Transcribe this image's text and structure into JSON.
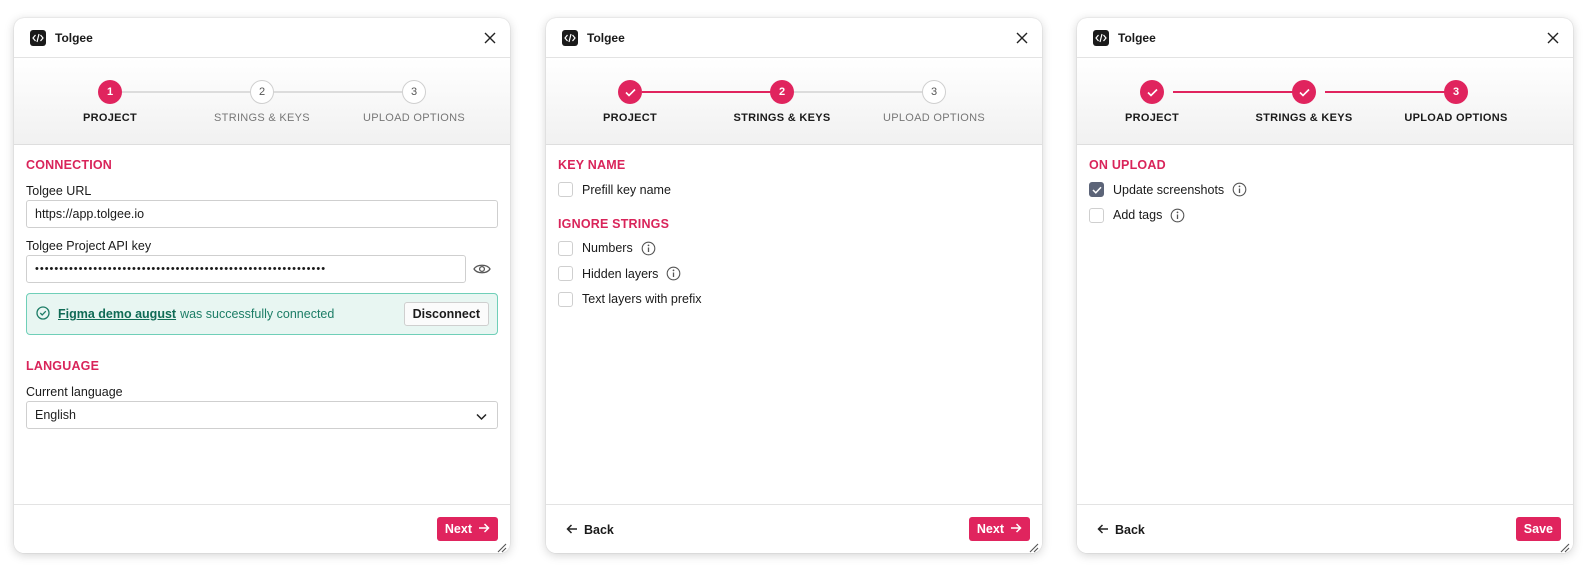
{
  "colors": {
    "accent": "#e0245e",
    "section": "#d9245a",
    "success_bg": "#e8f6f2",
    "success_border": "#6fcfb8",
    "checked": "#5c6478"
  },
  "app": {
    "title": "Tolgee",
    "icon": "code-brackets-icon"
  },
  "steps": [
    "PROJECT",
    "STRINGS & KEYS",
    "UPLOAD OPTIONS"
  ],
  "step_numbers": [
    "1",
    "2",
    "3"
  ],
  "panel1": {
    "connection_title": "CONNECTION",
    "url_label": "Tolgee URL",
    "url_value": "https://app.tolgee.io",
    "api_key_label": "Tolgee Project API key",
    "api_key_value": "••••••••••••••••••••••••••••••••••••••••••••••••••••••••••••",
    "success_project": "Figma demo august",
    "success_text": "was successfully connected",
    "disconnect_label": "Disconnect",
    "language_title": "LANGUAGE",
    "current_language_label": "Current language",
    "current_language_value": "English",
    "next_label": "Next"
  },
  "panel2": {
    "key_name_title": "KEY NAME",
    "prefill_label": "Prefill key name",
    "ignore_title": "IGNORE STRINGS",
    "numbers_label": "Numbers",
    "hidden_layers_label": "Hidden layers",
    "prefix_label": "Text layers with prefix",
    "back_label": "Back",
    "next_label": "Next"
  },
  "panel3": {
    "on_upload_title": "ON UPLOAD",
    "update_screenshots_label": "Update screenshots",
    "update_screenshots_checked": true,
    "add_tags_label": "Add tags",
    "back_label": "Back",
    "save_label": "Save"
  }
}
